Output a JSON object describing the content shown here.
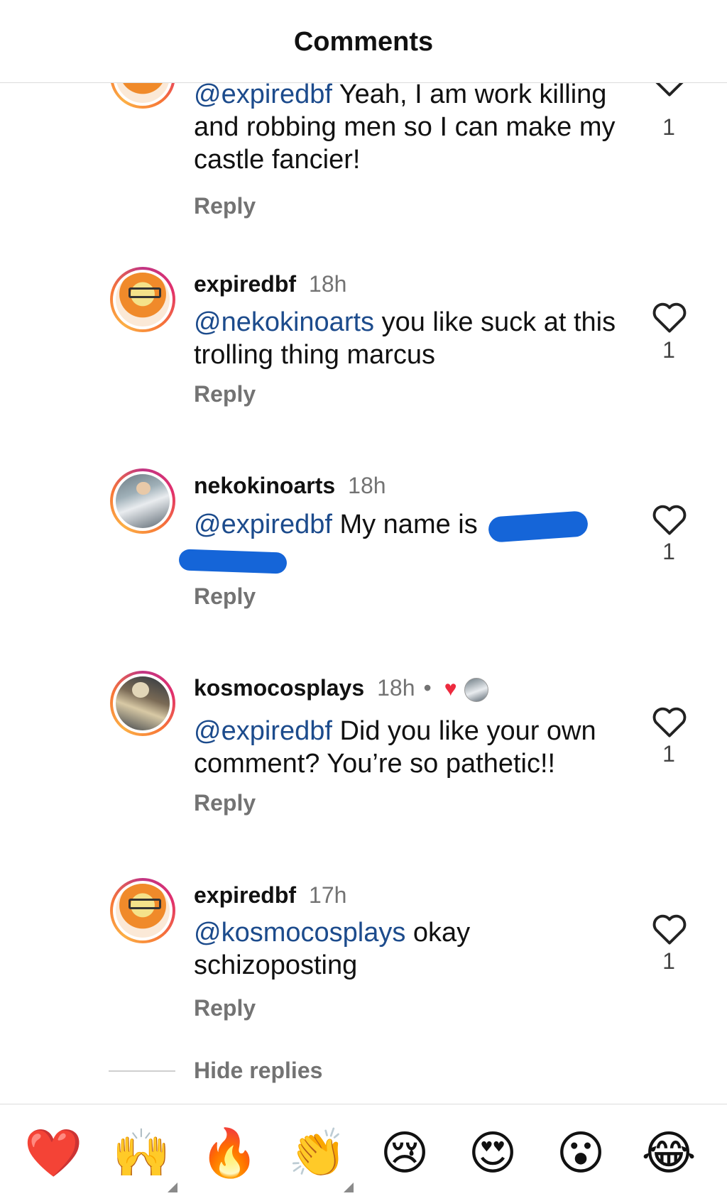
{
  "header": {
    "title": "Comments"
  },
  "comments": [
    {
      "username": "",
      "time": "",
      "mention": "@expiredbf",
      "text": " Yeah, I am work killing and robbing men so I can make my castle fancier!",
      "reply_label": "Reply",
      "like_count": "1"
    },
    {
      "username": "expiredbf",
      "time": "18h",
      "mention": "@nekokinoarts",
      "text": " you like suck at this trolling thing marcus",
      "reply_label": "Reply",
      "like_count": "1"
    },
    {
      "username": "nekokinoarts",
      "time": "18h",
      "mention": "@expiredbf",
      "text": " My name is",
      "reply_label": "Reply",
      "like_count": "1"
    },
    {
      "username": "kosmocosplays",
      "time": "18h",
      "dot": "•",
      "mention": "@expiredbf",
      "text": " Did you like your own comment? You’re so pathetic!!",
      "reply_label": "Reply",
      "like_count": "1"
    },
    {
      "username": "expiredbf",
      "time": "17h",
      "mention": "@kosmocosplays",
      "text": " okay schizoposting",
      "reply_label": "Reply",
      "like_count": "1"
    }
  ],
  "hide_replies": "Hide replies",
  "emoji_bar": {
    "emojis": [
      "❤️",
      "🙌",
      "🔥",
      "👏",
      "😢",
      "😍",
      "😮",
      "😂"
    ]
  },
  "icons": {
    "like": "heart-outline-icon",
    "liked_by_author": "heart-filled-icon"
  },
  "colors": {
    "mention": "#1c4b8c",
    "muted": "#737373",
    "like_red": "#ed2a3e",
    "redaction": "#1565d8"
  }
}
